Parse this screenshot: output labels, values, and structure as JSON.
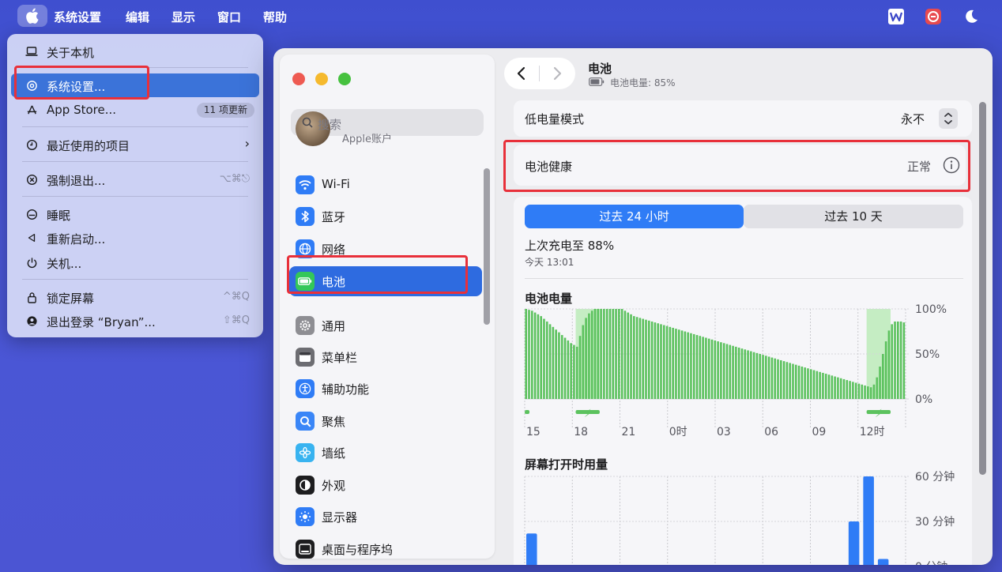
{
  "menubar": {
    "app_name": "系统设置",
    "items": [
      "编辑",
      "显示",
      "窗口",
      "帮助"
    ],
    "right_icons": [
      "wps-icon",
      "record-icon",
      "moon-icon"
    ]
  },
  "apple_menu": {
    "about": "关于本机",
    "settings": "系统设置...",
    "appstore": "App Store...",
    "appstore_badge": "11 项更新",
    "recent": "最近使用的项目",
    "force_quit": "强制退出...",
    "force_quit_shortcut": "⌥⌘⎋",
    "sleep": "睡眠",
    "restart": "重新启动...",
    "shutdown": "关机...",
    "lock": "锁定屏幕",
    "lock_shortcut": "^⌘Q",
    "logout": "退出登录 “Bryan”...",
    "logout_shortcut": "⇧⌘Q"
  },
  "sidebar": {
    "search_placeholder": "搜索",
    "account_label": "Apple账户",
    "items": [
      {
        "label": "Wi-Fi",
        "icon": "wifi-icon",
        "color": "#2f7cf6"
      },
      {
        "label": "蓝牙",
        "icon": "bluetooth-icon",
        "color": "#2f7cf6"
      },
      {
        "label": "网络",
        "icon": "globe-icon",
        "color": "#2f7cf6"
      },
      {
        "label": "电池",
        "icon": "battery-icon",
        "color": "#34c759",
        "selected": true
      },
      {
        "label": "通用",
        "icon": "gear-icon",
        "color": "#8e8e93"
      },
      {
        "label": "菜单栏",
        "icon": "menubar-icon",
        "color": "#6d6d72"
      },
      {
        "label": "辅助功能",
        "icon": "accessibility-icon",
        "color": "#2f7cf6"
      },
      {
        "label": "聚焦",
        "icon": "search-icon",
        "color": "#3a86f7"
      },
      {
        "label": "墙纸",
        "icon": "flower-icon",
        "color": "#38b3f0"
      },
      {
        "label": "外观",
        "icon": "appearance-icon",
        "color": "#1d1d1f"
      },
      {
        "label": "显示器",
        "icon": "sun-icon",
        "color": "#2f7cf6"
      },
      {
        "label": "桌面与程序坞",
        "icon": "dock-icon",
        "color": "#1d1d1f"
      }
    ]
  },
  "header": {
    "title": "电池",
    "subtitle": "电池电量: 85%"
  },
  "low_power": {
    "label": "低电量模式",
    "value": "永不"
  },
  "health": {
    "label": "电池健康",
    "value": "正常"
  },
  "tabs": {
    "active": "过去 24 小时",
    "inactive": "过去 10 天"
  },
  "last_charge": {
    "text": "上次充电至 88%",
    "time": "今天 13:01"
  },
  "colors": {
    "accent": "#2f7cf6",
    "battery_green": "#5cc25e",
    "charging_band": "#c5edc3",
    "usage_blue": "#2f7cf6",
    "highlight_red": "#e8303a"
  },
  "chart_data": [
    {
      "type": "bar",
      "title": "电池电量",
      "x_tick_labels": [
        "15",
        "18",
        "21",
        "0时",
        "03",
        "06",
        "09",
        "12时"
      ],
      "y_tick_labels": [
        "100%",
        "50%",
        "0%"
      ],
      "ylim": [
        0,
        100
      ],
      "unit": "%",
      "values": [
        100,
        99,
        98,
        96,
        94,
        92,
        89,
        86,
        83,
        80,
        77,
        74,
        71,
        68,
        65,
        62,
        60,
        58,
        70,
        82,
        90,
        95,
        98,
        100,
        100,
        100,
        100,
        100,
        100,
        100,
        100,
        100,
        100,
        98,
        96,
        94,
        92,
        91,
        90,
        89,
        88,
        87,
        86,
        85,
        84,
        83,
        82,
        81,
        80,
        79,
        78,
        77,
        76,
        75,
        74,
        73,
        72,
        71,
        70,
        69,
        68,
        67,
        66,
        65,
        64,
        63,
        62,
        61,
        60,
        59,
        58,
        57,
        56,
        55,
        54,
        53,
        52,
        51,
        50,
        49,
        48,
        47,
        46,
        45,
        44,
        43,
        42,
        41,
        40,
        39,
        38,
        37,
        36,
        35,
        34,
        33,
        32,
        31,
        30,
        29,
        28,
        27,
        26,
        25,
        24,
        23,
        22,
        21,
        20,
        19,
        18,
        17,
        16,
        15,
        14,
        13,
        16,
        24,
        36,
        50,
        64,
        76,
        83,
        86,
        86,
        86,
        85
      ],
      "charging_ranges": [
        [
          17,
          24
        ],
        [
          114,
          121
        ]
      ],
      "charging_label": "⚡"
    },
    {
      "type": "bar",
      "title": "屏幕打开时用量",
      "y_tick_labels": [
        "60 分钟",
        "30 分钟",
        "0 分钟"
      ],
      "ylim": [
        0,
        60
      ],
      "unit": "分钟",
      "values": [
        22,
        0,
        0,
        0,
        0,
        0,
        0,
        0,
        0,
        0,
        0,
        0,
        0,
        0,
        0,
        0,
        0,
        0,
        0,
        0,
        0,
        0,
        30,
        60,
        5,
        0
      ]
    }
  ]
}
